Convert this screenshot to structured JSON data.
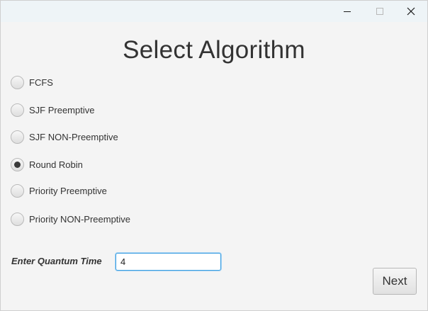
{
  "window": {
    "title": "",
    "controls": {
      "minimize_icon": "minimize-icon",
      "maximize_icon": "maximize-icon",
      "close_icon": "close-icon"
    }
  },
  "heading": "Select Algorithm",
  "algorithms": [
    {
      "label": "FCFS",
      "selected": false
    },
    {
      "label": "SJF Preemptive",
      "selected": false
    },
    {
      "label": "SJF NON-Preemptive",
      "selected": false
    },
    {
      "label": "Round Robin",
      "selected": true
    },
    {
      "label": "Priority Preemptive",
      "selected": false
    },
    {
      "label": "Priority NON-Preemptive",
      "selected": false
    }
  ],
  "quantum": {
    "label": "Enter Quantum Time",
    "value": "4"
  },
  "next_button": "Next",
  "colors": {
    "background": "#f4f4f4",
    "focus_border": "#3c9fe0",
    "text": "#333333"
  }
}
